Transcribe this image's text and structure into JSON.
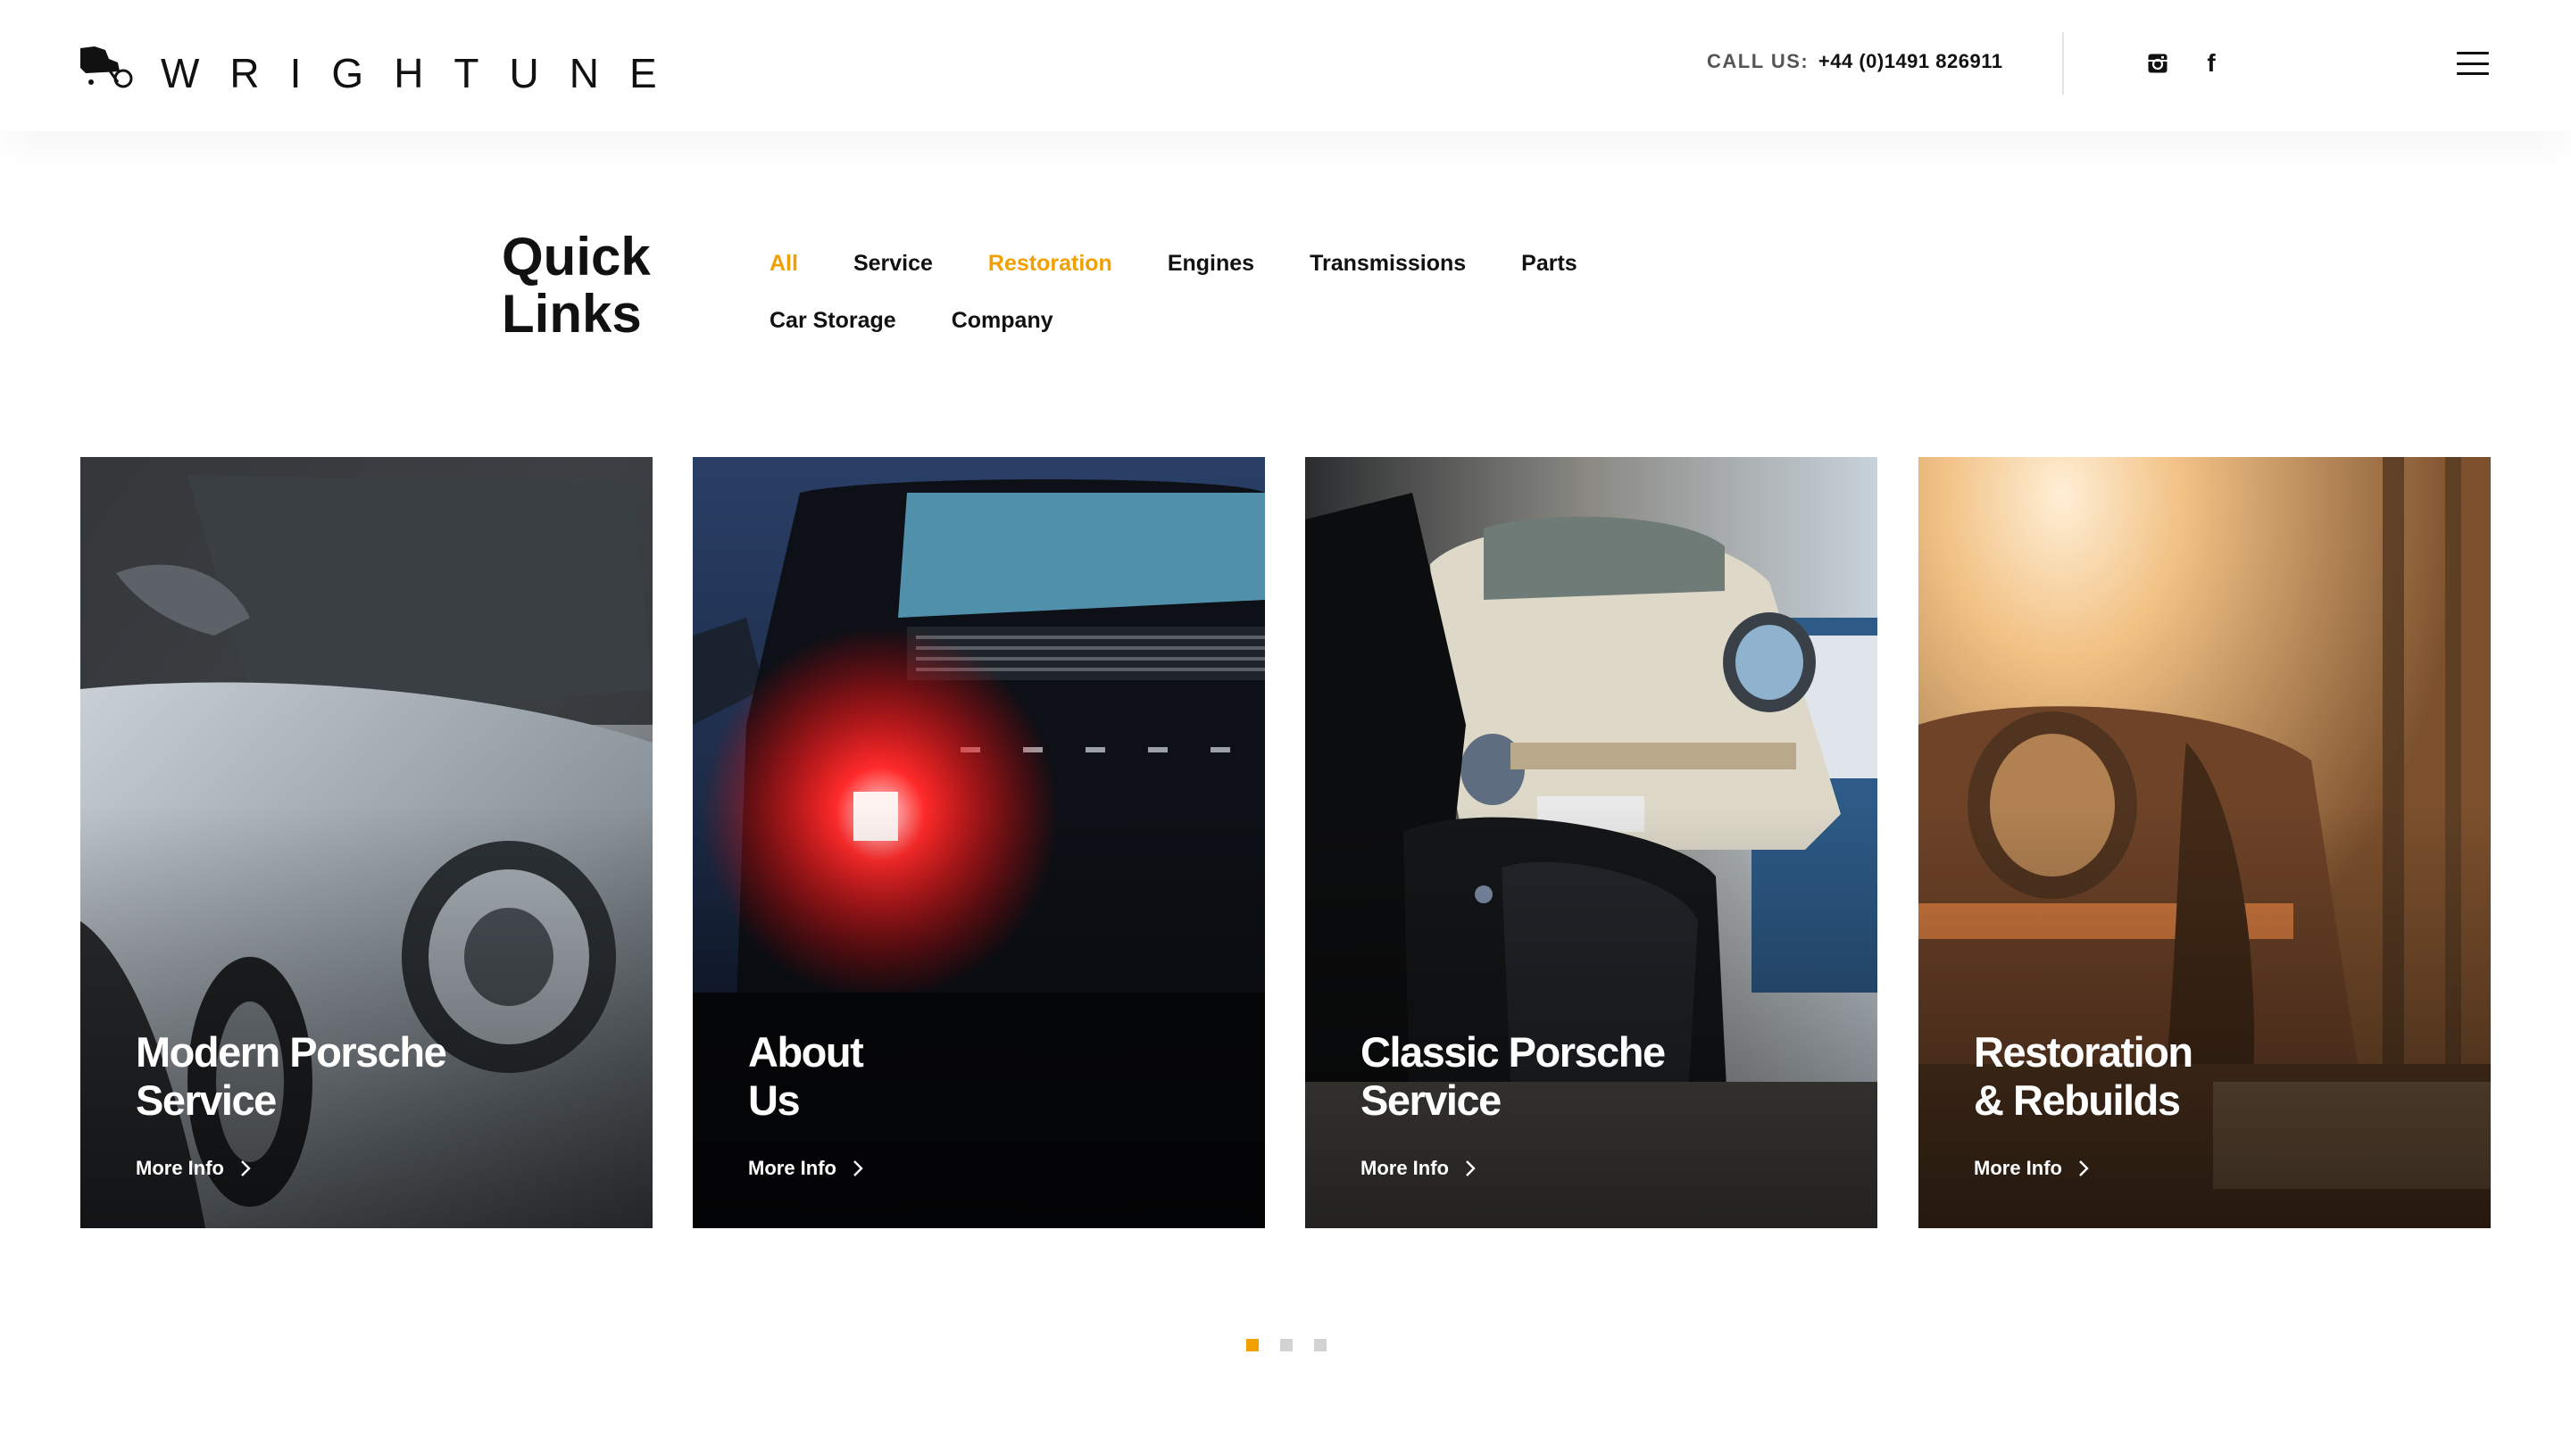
{
  "brand": {
    "name": "WRIGHTUNE",
    "logo_icon": "car-logo-icon"
  },
  "header": {
    "call_label": "CALL US:",
    "call_number": "+44 (0)1491 826911",
    "social": [
      {
        "icon": "instagram-icon"
      },
      {
        "icon": "facebook-icon",
        "glyph": "f"
      }
    ],
    "menu_icon": "hamburger-menu-icon"
  },
  "quick_links": {
    "title_line1": "Quick",
    "title_line2": "Links",
    "items": [
      {
        "label": "All",
        "active": true
      },
      {
        "label": "Service",
        "active": false
      },
      {
        "label": "Restoration",
        "active": true
      },
      {
        "label": "Engines",
        "active": false
      },
      {
        "label": "Transmissions",
        "active": false
      },
      {
        "label": "Parts",
        "active": false
      },
      {
        "label": "Car Storage",
        "active": false
      },
      {
        "label": "Company",
        "active": false
      }
    ]
  },
  "cards": [
    {
      "title_line1": "Modern Porsche",
      "title_line2": "Service",
      "more": "More Info"
    },
    {
      "title_line1": "About",
      "title_line2": "Us",
      "more": "More Info"
    },
    {
      "title_line1": "Classic Porsche",
      "title_line2": "Service",
      "more": "More Info"
    },
    {
      "title_line1": "Restoration",
      "title_line2": "& Rebuilds",
      "more": "More Info"
    }
  ],
  "pager": {
    "count": 3,
    "active_index": 0
  },
  "colors": {
    "accent": "#f2a000",
    "text": "#111111",
    "dot_inactive": "#d2d2d2"
  }
}
